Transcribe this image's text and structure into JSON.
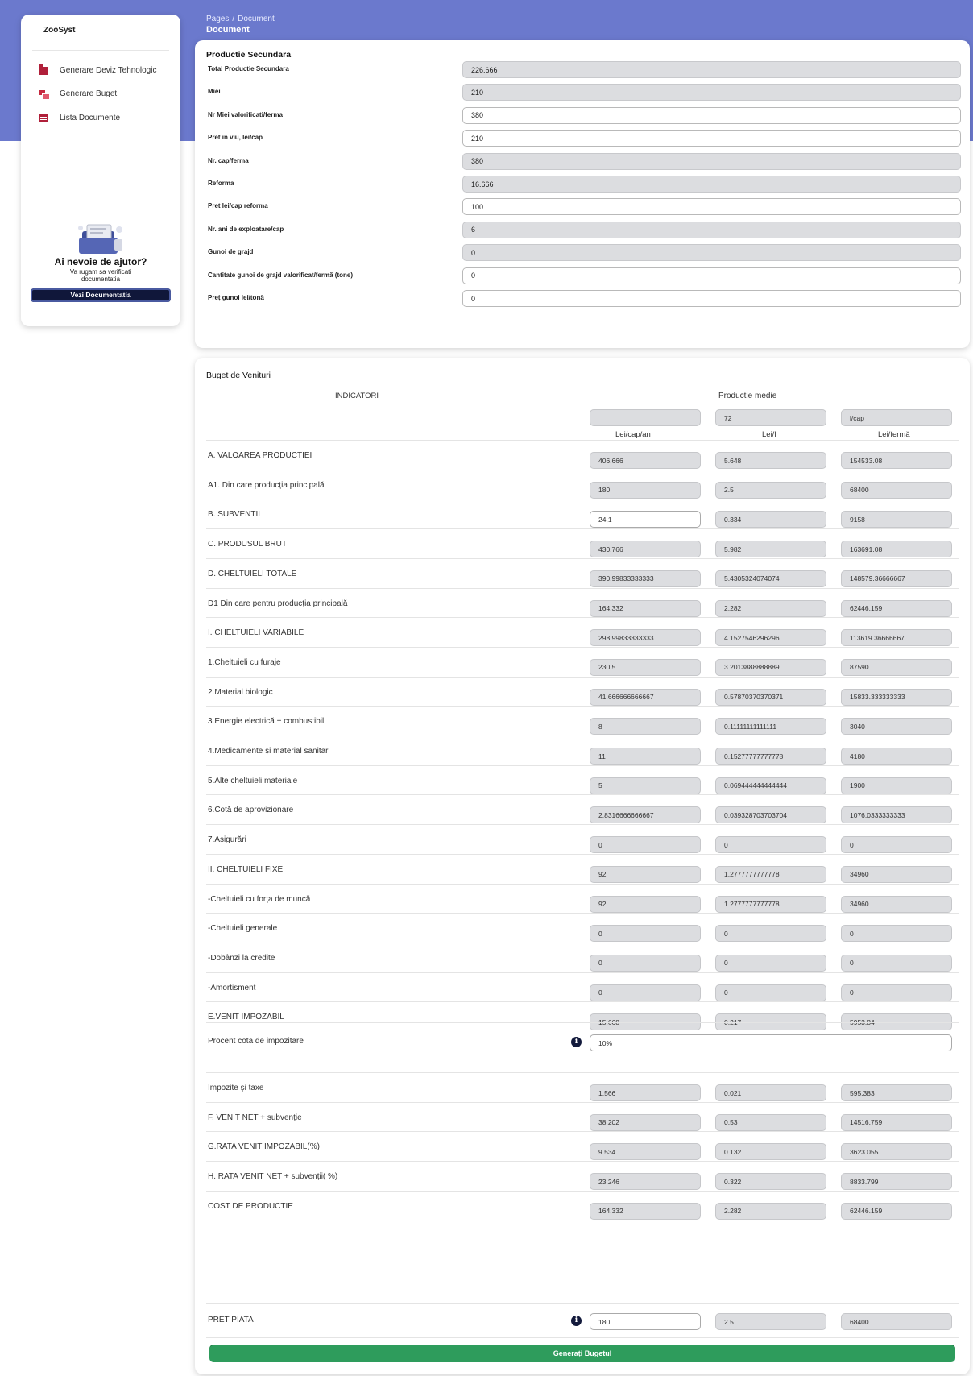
{
  "header": {
    "breadcrumb_root": "Pages",
    "breadcrumb_sep": "/",
    "breadcrumb_current": "Document",
    "title": "Document"
  },
  "sidebar": {
    "brand": "ZooSyst",
    "items": [
      {
        "label": "Generare Deviz Tehnologic",
        "icon": "folder-icon"
      },
      {
        "label": "Generare Buget",
        "icon": "cards-icon"
      },
      {
        "label": "Lista Documente",
        "icon": "list-icon"
      }
    ],
    "help_title": "Ai nevoie de ajutor?",
    "help_subtitle": "Va rugam sa verificati documentatia",
    "help_button": "Vezi Documentatia"
  },
  "productie_secundara": {
    "title": "Productie Secundara",
    "fields": [
      {
        "label": "Total Productie Secundara",
        "value": "226.666",
        "readonly": true
      },
      {
        "label": "Miei",
        "value": "210",
        "readonly": true
      },
      {
        "label": "Nr Miei valorificati/ferma",
        "value": "380",
        "readonly": false
      },
      {
        "label": "Pret in viu, lei/cap",
        "value": "210",
        "readonly": false
      },
      {
        "label": "Nr. cap/ferma",
        "value": "380",
        "readonly": true
      },
      {
        "label": "Reforma",
        "value": "16.666",
        "readonly": true
      },
      {
        "label": "Pret lei/cap reforma",
        "value": "100",
        "readonly": false
      },
      {
        "label": "Nr. ani de exploatare/cap",
        "value": "6",
        "readonly": true
      },
      {
        "label": "Gunoi de grajd",
        "value": "0",
        "readonly": true
      },
      {
        "label": "Cantitate gunoi de grajd valorificat/fermă (tone)",
        "value": "0",
        "readonly": false
      },
      {
        "label": "Preț gunoi lei/tonă",
        "value": "0",
        "readonly": false
      }
    ]
  },
  "buget": {
    "title": "Buget de Venituri",
    "indicatori_header": "INDICATORI",
    "productie_medie_header": "Productie medie",
    "top_inputs": [
      "",
      "72",
      "l/cap"
    ],
    "col_headers": [
      "Lei/cap/an",
      "Lei/l",
      "Lei/fermă"
    ],
    "rows": [
      {
        "label": "A. VALOAREA PRODUCTIEI",
        "values": [
          "406.666",
          "5.648",
          "154533.08"
        ]
      },
      {
        "label": "A1. Din care producția principală",
        "values": [
          "180",
          "2.5",
          "68400"
        ]
      },
      {
        "label": "B. SUBVENTII",
        "values": [
          "24,1",
          "0.334",
          "9158"
        ],
        "editable": true
      },
      {
        "label": "C. PRODUSUL BRUT",
        "values": [
          "430.766",
          "5.982",
          "163691.08"
        ]
      },
      {
        "label": "D. CHELTUIELI TOTALE",
        "values": [
          "390.99833333333",
          "5.4305324074074",
          "148579.36666667"
        ]
      },
      {
        "label": "D1 Din care pentru producția principală",
        "values": [
          "164.332",
          "2.282",
          "62446.159"
        ]
      },
      {
        "label": "I. CHELTUIELI VARIABILE",
        "values": [
          "298.99833333333",
          "4.1527546296296",
          "113619.36666667"
        ]
      },
      {
        "label": "1.Cheltuieli cu furaje",
        "values": [
          "230.5",
          "3.2013888888889",
          "87590"
        ]
      },
      {
        "label": "2.Material biologic",
        "values": [
          "41.666666666667",
          "0.57870370370371",
          "15833.333333333"
        ]
      },
      {
        "label": "3.Energie electrică + combustibil",
        "values": [
          "8",
          "0.11111111111111",
          "3040"
        ]
      },
      {
        "label": "4.Medicamente și material sanitar",
        "values": [
          "11",
          "0.15277777777778",
          "4180"
        ]
      },
      {
        "label": "5.Alte cheltuieli materiale",
        "values": [
          "5",
          "0.069444444444444",
          "1900"
        ]
      },
      {
        "label": "6.Cotă de aprovizionare",
        "values": [
          "2.8316666666667",
          "0.039328703703704",
          "1076.0333333333"
        ]
      },
      {
        "label": "7.Asigurări",
        "values": [
          "0",
          "0",
          "0"
        ]
      },
      {
        "label": "II. CHELTUIELI FIXE",
        "values": [
          "92",
          "1.2777777777778",
          "34960"
        ]
      },
      {
        "label": "-Cheltuieli cu forța de muncă",
        "values": [
          "92",
          "1.2777777777778",
          "34960"
        ]
      },
      {
        "label": "-Cheltuieli generale",
        "values": [
          "0",
          "0",
          "0"
        ]
      },
      {
        "label": "-Dobânzi la credite",
        "values": [
          "0",
          "0",
          "0"
        ]
      },
      {
        "label": "-Amortisment",
        "values": [
          "0",
          "0",
          "0"
        ]
      },
      {
        "label": "E.VENIT IMPOZABIL",
        "values": [
          "15.668",
          "0.217",
          "5953.84"
        ]
      }
    ],
    "procent": {
      "label": "Procent cota de impozitare",
      "value": "10%"
    },
    "rows2": [
      {
        "label": "Impozite și taxe",
        "values": [
          "1.566",
          "0.021",
          "595.383"
        ]
      },
      {
        "label": "F. VENIT NET + subvenție",
        "values": [
          "38.202",
          "0.53",
          "14516.759"
        ]
      },
      {
        "label": "G.RATA VENIT IMPOZABIL(%)",
        "values": [
          "9.534",
          "0.132",
          "3623.055"
        ]
      },
      {
        "label": "H. RATA VENIT NET + subvenții( %)",
        "values": [
          "23.246",
          "0.322",
          "8833.799"
        ]
      },
      {
        "label": "COST DE PRODUCTIE",
        "values": [
          "164.332",
          "2.282",
          "62446.159"
        ]
      }
    ],
    "pret_piata": {
      "label": "PRET PIATA",
      "values": [
        "180",
        "2.5",
        "68400"
      ]
    },
    "info_symbol": "i",
    "generate_button": "Generați Bugetul"
  }
}
